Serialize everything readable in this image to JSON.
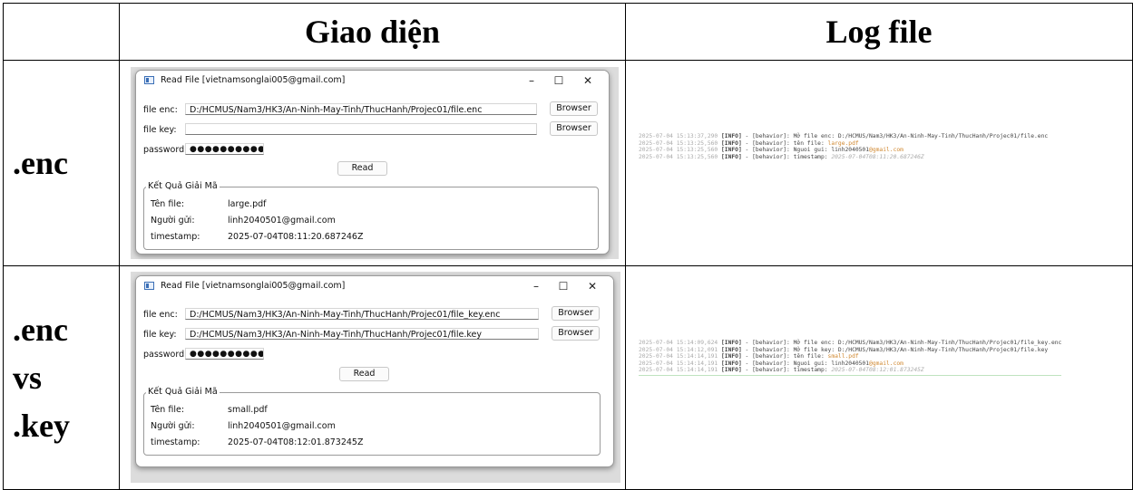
{
  "table": {
    "headers": [
      "",
      "Giao diện",
      "Log file"
    ],
    "rows": [
      {
        "label": ".enc",
        "window": {
          "title": "Read File [vietnamsonglai005@gmail.com]",
          "file_enc_label": "file enc:",
          "file_enc_value": "D:/HCMUS/Nam3/HK3/An-Ninh-May-Tinh/ThucHanh/Projec01/file.enc",
          "file_key_label": "file key:",
          "file_key_value": "",
          "browser_label": "Browser",
          "password_label": "password",
          "password_value": "●●●●●●●●●●●●",
          "read_label": "Read",
          "group_title": "Kết Quả Giải Mã",
          "result_rows": [
            {
              "label": "Tên file:",
              "value": "large.pdf"
            },
            {
              "label": "Người gửi:",
              "value": "linh2040501@gmail.com"
            },
            {
              "label": "timestamp:",
              "value": "2025-07-04T08:11:20.687246Z"
            }
          ]
        },
        "log_lines": [
          {
            "ts": "2025-07-04 15:13:37,290",
            "level": "[INFO]",
            "msg": " - [behavior]: Mở file enc: D:/HCMUS/Nam3/HK3/An-Ninh-May-Tinh/ThucHanh/Projec01/file.enc",
            "hl": ""
          },
          {
            "ts": "2025-07-04 15:13:25,560",
            "level": "[INFO]",
            "msg": " - [behavior]: tên file: ",
            "hl": "large.pdf"
          },
          {
            "ts": "2025-07-04 15:13:25,560",
            "level": "[INFO]",
            "msg": " - [behavior]: Nguoi gui: linh2040501",
            "hl": "@gmail.com"
          },
          {
            "ts": "2025-07-04 15:13:25,560",
            "level": "[INFO]",
            "msg": " - [behavior]: timestamp: ",
            "hl": "2025-07-04T08:11:20.687246Z"
          }
        ]
      },
      {
        "label_lines": [
          ".enc",
          "vs",
          ".key"
        ],
        "window": {
          "title": "Read File [vietnamsonglai005@gmail.com]",
          "file_enc_label": "file enc:",
          "file_enc_value": "D:/HCMUS/Nam3/HK3/An-Ninh-May-Tinh/ThucHanh/Projec01/file_key.enc",
          "file_key_label": "file key:",
          "file_key_value": "D:/HCMUS/Nam3/HK3/An-Ninh-May-Tinh/ThucHanh/Projec01/file.key",
          "browser_label": "Browser",
          "password_label": "password",
          "password_value": "●●●●●●●●●●●●",
          "read_label": "Read",
          "group_title": "Kết Quả Giải Mã",
          "result_rows": [
            {
              "label": "Tên file:",
              "value": "small.pdf"
            },
            {
              "label": "Người gửi:",
              "value": "linh2040501@gmail.com"
            },
            {
              "label": "timestamp:",
              "value": "2025-07-04T08:12:01.873245Z"
            }
          ]
        },
        "log_lines": [
          {
            "ts": "2025-07-04 15:14:09,624",
            "level": "[INFO]",
            "msg": " - [behavior]: Mở file enc: D:/HCMUS/Nam3/HK3/An-Ninh-May-Tinh/ThucHanh/Projec01/file_key.enc",
            "hl": ""
          },
          {
            "ts": "2025-07-04 15:14:12,091",
            "level": "[INFO]",
            "msg": " - [behavior]: Mở file key: D:/HCMUS/Nam3/HK3/An-Ninh-May-Tinh/ThucHanh/Projec01/file.key",
            "hl": ""
          },
          {
            "ts": "2025-07-04 15:14:14,191",
            "level": "[INFO]",
            "msg": " - [behavior]: tên file: ",
            "hl": "small.pdf"
          },
          {
            "ts": "2025-07-04 15:14:14,191",
            "level": "[INFO]",
            "msg": " - [behavior]: Nguoi gui: linh2040501",
            "hl": "@gmail.com"
          },
          {
            "ts": "2025-07-04 15:14:14,191",
            "level": "[INFO]",
            "msg": " - [behavior]: timestamp: ",
            "hl": "2025-07-04T08:12:01.873245Z"
          }
        ]
      }
    ]
  },
  "window_controls": {
    "minimize": "–",
    "maximize": "☐",
    "close": "✕"
  }
}
